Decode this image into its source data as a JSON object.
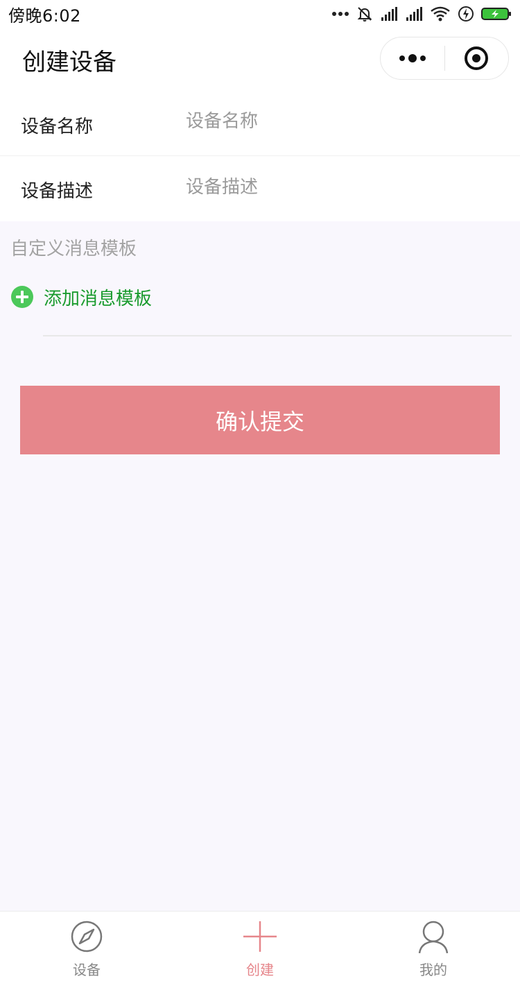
{
  "status_bar": {
    "time": "傍晚6:02"
  },
  "nav": {
    "title": "创建设备"
  },
  "form": {
    "device_name_label": "设备名称",
    "device_name_placeholder": "设备名称",
    "device_desc_label": "设备描述",
    "device_desc_placeholder": "设备描述"
  },
  "template_section": {
    "title": "自定义消息模板",
    "add_label": "添加消息模板"
  },
  "submit": {
    "label": "确认提交"
  },
  "tab_bar": {
    "tabs": [
      {
        "label": "设备",
        "icon": "compass-icon",
        "active": false
      },
      {
        "label": "创建",
        "icon": "plus-icon",
        "active": true
      },
      {
        "label": "我的",
        "icon": "user-icon",
        "active": false
      }
    ]
  },
  "colors": {
    "accent": "#e6868b",
    "add_green": "#1a9b2e",
    "page_background": "#f9f7fd"
  }
}
